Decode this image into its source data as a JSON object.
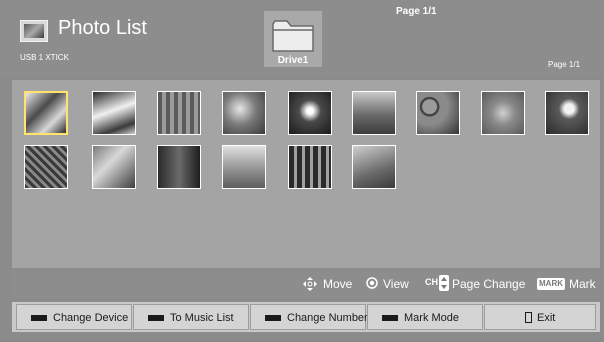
{
  "header": {
    "title": "Photo List",
    "device": "USB 1 XTICK",
    "page_top": "Page 1/1",
    "page_right": "Page 1/1",
    "drive_label": "Drive1",
    "drive_icon": "folder-icon"
  },
  "thumbnails": [
    {
      "name": "photo-01",
      "selected": true
    },
    {
      "name": "photo-02"
    },
    {
      "name": "photo-03"
    },
    {
      "name": "photo-04"
    },
    {
      "name": "photo-05"
    },
    {
      "name": "photo-06"
    },
    {
      "name": "photo-07"
    },
    {
      "name": "photo-08"
    },
    {
      "name": "photo-09"
    },
    {
      "name": "photo-10"
    },
    {
      "name": "photo-11"
    },
    {
      "name": "photo-12"
    },
    {
      "name": "photo-13"
    },
    {
      "name": "photo-14"
    },
    {
      "name": "photo-15"
    }
  ],
  "controls": {
    "move": "Move",
    "view": "View",
    "ch_badge": "CH",
    "page_change": "Page Change",
    "mark_badge": "MARK",
    "mark": "Mark"
  },
  "buttons": {
    "change_device": "Change Device",
    "to_music_list": "To Music List",
    "change_numbers": "Change Numbers",
    "mark_mode": "Mark Mode",
    "exit": "Exit"
  },
  "colors": {
    "selected_border": "#ffe36a",
    "panel": "#a4a4a4",
    "button": "#d4d4d4"
  }
}
